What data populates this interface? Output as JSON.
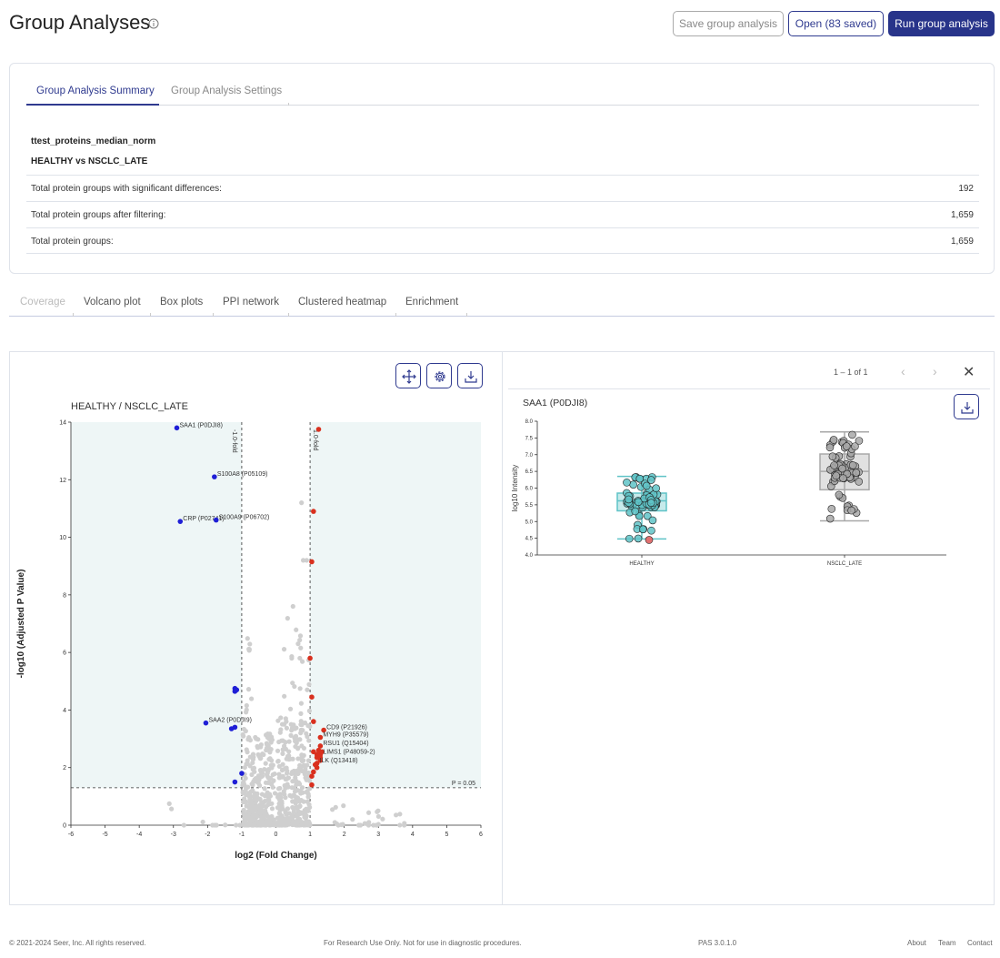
{
  "header": {
    "title": "Group Analyses",
    "save_label": "Save group analysis",
    "open_label": "Open (83 saved)",
    "run_label": "Run group analysis"
  },
  "summary": {
    "tabs": [
      {
        "label": "Group Analysis Summary"
      },
      {
        "label": "Group Analysis Settings"
      }
    ],
    "analysis_name": "ttest_proteins_median_norm",
    "comparison": "HEALTHY vs NSCLC_LATE",
    "rows": [
      {
        "label": "Total protein groups with significant differences:",
        "value": "192"
      },
      {
        "label": "Total protein groups after filtering:",
        "value": "1,659"
      },
      {
        "label": "Total protein groups:",
        "value": "1,659"
      }
    ]
  },
  "viz_tabs": [
    {
      "label": "Coverage"
    },
    {
      "label": "Volcano plot"
    },
    {
      "label": "Box plots"
    },
    {
      "label": "PPI network"
    },
    {
      "label": "Clustered heatmap"
    },
    {
      "label": "Enrichment"
    }
  ],
  "volcano": {
    "icons": [
      "move-icon",
      "gear-icon",
      "download-icon"
    ]
  },
  "boxpanel": {
    "pager": "1 – 1 of 1",
    "protein": "SAA1 (P0DJI8)",
    "icons": [
      "chevron-left-icon",
      "chevron-right-icon",
      "close-icon",
      "download-icon"
    ]
  },
  "footer": {
    "copyright": "© 2021-2024 Seer, Inc. All rights reserved.",
    "research": "For Research Use Only. Not for use in diagnostic procedures.",
    "version": "PAS 3.0.1.0",
    "links": [
      "About",
      "Team",
      "Contact"
    ]
  },
  "chart_data": [
    {
      "type": "scatter",
      "title": "HEALTHY / NSCLC_LATE",
      "xlabel": "log2 (Fold Change)",
      "ylabel": "-log10 (Adjusted P Value)",
      "xlim": [
        -6,
        6
      ],
      "ylim": [
        0,
        14
      ],
      "xticks": [
        -6,
        -5,
        -4,
        -3,
        -2,
        -1,
        0,
        1,
        2,
        3,
        4,
        5,
        6
      ],
      "yticks": [
        0,
        2,
        4,
        6,
        8,
        10,
        12,
        14
      ],
      "thresholds": {
        "fold_lines": [
          -1,
          1
        ],
        "fold_labels": [
          "-1.0-fold",
          "1.0-fold"
        ],
        "p_line": 1.3,
        "p_label": "P = 0.05"
      },
      "colors": {
        "down": "#1f1fd6",
        "up": "#d9301e",
        "ns": "#cfcfcf",
        "highlight_bg": "#eef6f6"
      },
      "labeled_points": [
        {
          "label": "SAA1 (P0DJI8)",
          "x": -2.9,
          "y": 13.8,
          "group": "down"
        },
        {
          "label": "S100A8 (P05109)",
          "x": -1.8,
          "y": 12.1,
          "group": "down"
        },
        {
          "label": "CRP (P02741)",
          "x": -2.8,
          "y": 10.55,
          "group": "down"
        },
        {
          "label": "S100A9 (P06702)",
          "x": -1.75,
          "y": 10.6,
          "group": "down"
        },
        {
          "label": "SAA2 (P0DJI9)",
          "x": -2.05,
          "y": 3.55,
          "group": "down"
        },
        {
          "label": "CD9 (P21926)",
          "x": 1.4,
          "y": 3.3,
          "group": "up"
        },
        {
          "label": "MYH9 (P35579)",
          "x": 1.3,
          "y": 3.05,
          "group": "up"
        },
        {
          "label": "RSU1 (Q15404)",
          "x": 1.3,
          "y": 2.75,
          "group": "up"
        },
        {
          "label": "LIMS1 (P48059-2)",
          "x": 1.3,
          "y": 2.45,
          "group": "up"
        },
        {
          "label": "ILK (Q13418)",
          "x": 1.2,
          "y": 2.15,
          "group": "up"
        }
      ],
      "down_points": [
        [
          -1.2,
          4.75
        ],
        [
          -1.2,
          4.65
        ],
        [
          -1.15,
          4.7
        ],
        [
          -1.3,
          3.35
        ],
        [
          -1.2,
          3.4
        ],
        [
          -1.0,
          1.8
        ],
        [
          -1.2,
          1.5
        ]
      ],
      "up_points": [
        [
          1.25,
          13.75
        ],
        [
          1.1,
          10.9
        ],
        [
          1.05,
          9.15
        ],
        [
          1.0,
          5.8
        ],
        [
          1.05,
          4.45
        ],
        [
          1.1,
          3.6
        ],
        [
          1.25,
          2.6
        ],
        [
          1.35,
          2.55
        ],
        [
          1.2,
          2.35
        ],
        [
          1.3,
          2.25
        ],
        [
          1.15,
          2.1
        ],
        [
          1.2,
          2.0
        ],
        [
          1.1,
          1.85
        ],
        [
          1.05,
          1.7
        ],
        [
          1.2,
          2.45
        ],
        [
          1.3,
          2.35
        ],
        [
          1.1,
          2.55
        ],
        [
          1.05,
          1.4
        ]
      ]
    },
    {
      "type": "box",
      "title": "SAA1 (P0DJI8)",
      "ylabel": "log10 Intensity",
      "ylim": [
        4.0,
        8.0
      ],
      "yticks": [
        "4.0",
        "4.5",
        "5.0",
        "5.5",
        "6.0",
        "6.5",
        "7.0",
        "7.5",
        "8.0"
      ],
      "categories": [
        "HEALTHY",
        "NSCLC_LATE"
      ],
      "boxes": [
        {
          "name": "HEALTHY",
          "min": 4.48,
          "q1": 5.32,
          "median": 5.62,
          "q3": 5.85,
          "max": 6.35,
          "color": "#5fc3c7",
          "outlier": 4.45
        },
        {
          "name": "NSCLC_LATE",
          "min": 5.02,
          "q1": 5.95,
          "median": 6.5,
          "q3": 7.02,
          "max": 7.68,
          "color": "#a8a8a8"
        }
      ]
    }
  ]
}
